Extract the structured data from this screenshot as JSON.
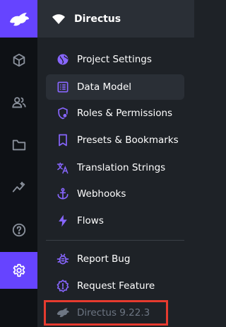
{
  "app": {
    "project_name": "Directus",
    "logo": "rabbit-logo-icon"
  },
  "module_bar": {
    "items": [
      {
        "icon": "cube-icon"
      },
      {
        "icon": "users-icon"
      },
      {
        "icon": "folder-icon"
      },
      {
        "icon": "insights-icon"
      },
      {
        "icon": "help-icon"
      },
      {
        "icon": "settings-icon",
        "active": true
      }
    ]
  },
  "nav": {
    "items": [
      {
        "label": "Project Settings",
        "icon": "globe-icon"
      },
      {
        "label": "Data Model",
        "icon": "list-alt-icon",
        "active": true
      },
      {
        "label": "Roles & Permissions",
        "icon": "roles-icon"
      },
      {
        "label": "Presets & Bookmarks",
        "icon": "bookmark-icon"
      },
      {
        "label": "Translation Strings",
        "icon": "translate-icon"
      },
      {
        "label": "Webhooks",
        "icon": "anchor-icon"
      },
      {
        "label": "Flows",
        "icon": "bolt-icon"
      }
    ],
    "footer_items": [
      {
        "label": "Report Bug",
        "icon": "bug-icon"
      },
      {
        "label": "Request Feature",
        "icon": "feature-icon"
      },
      {
        "label": "Directus 9.22.3",
        "icon": "rabbit-icon"
      }
    ]
  },
  "colors": {
    "accent": "#6644ff",
    "icon_purple": "#8866ff",
    "highlight_red": "#e63b2f"
  }
}
